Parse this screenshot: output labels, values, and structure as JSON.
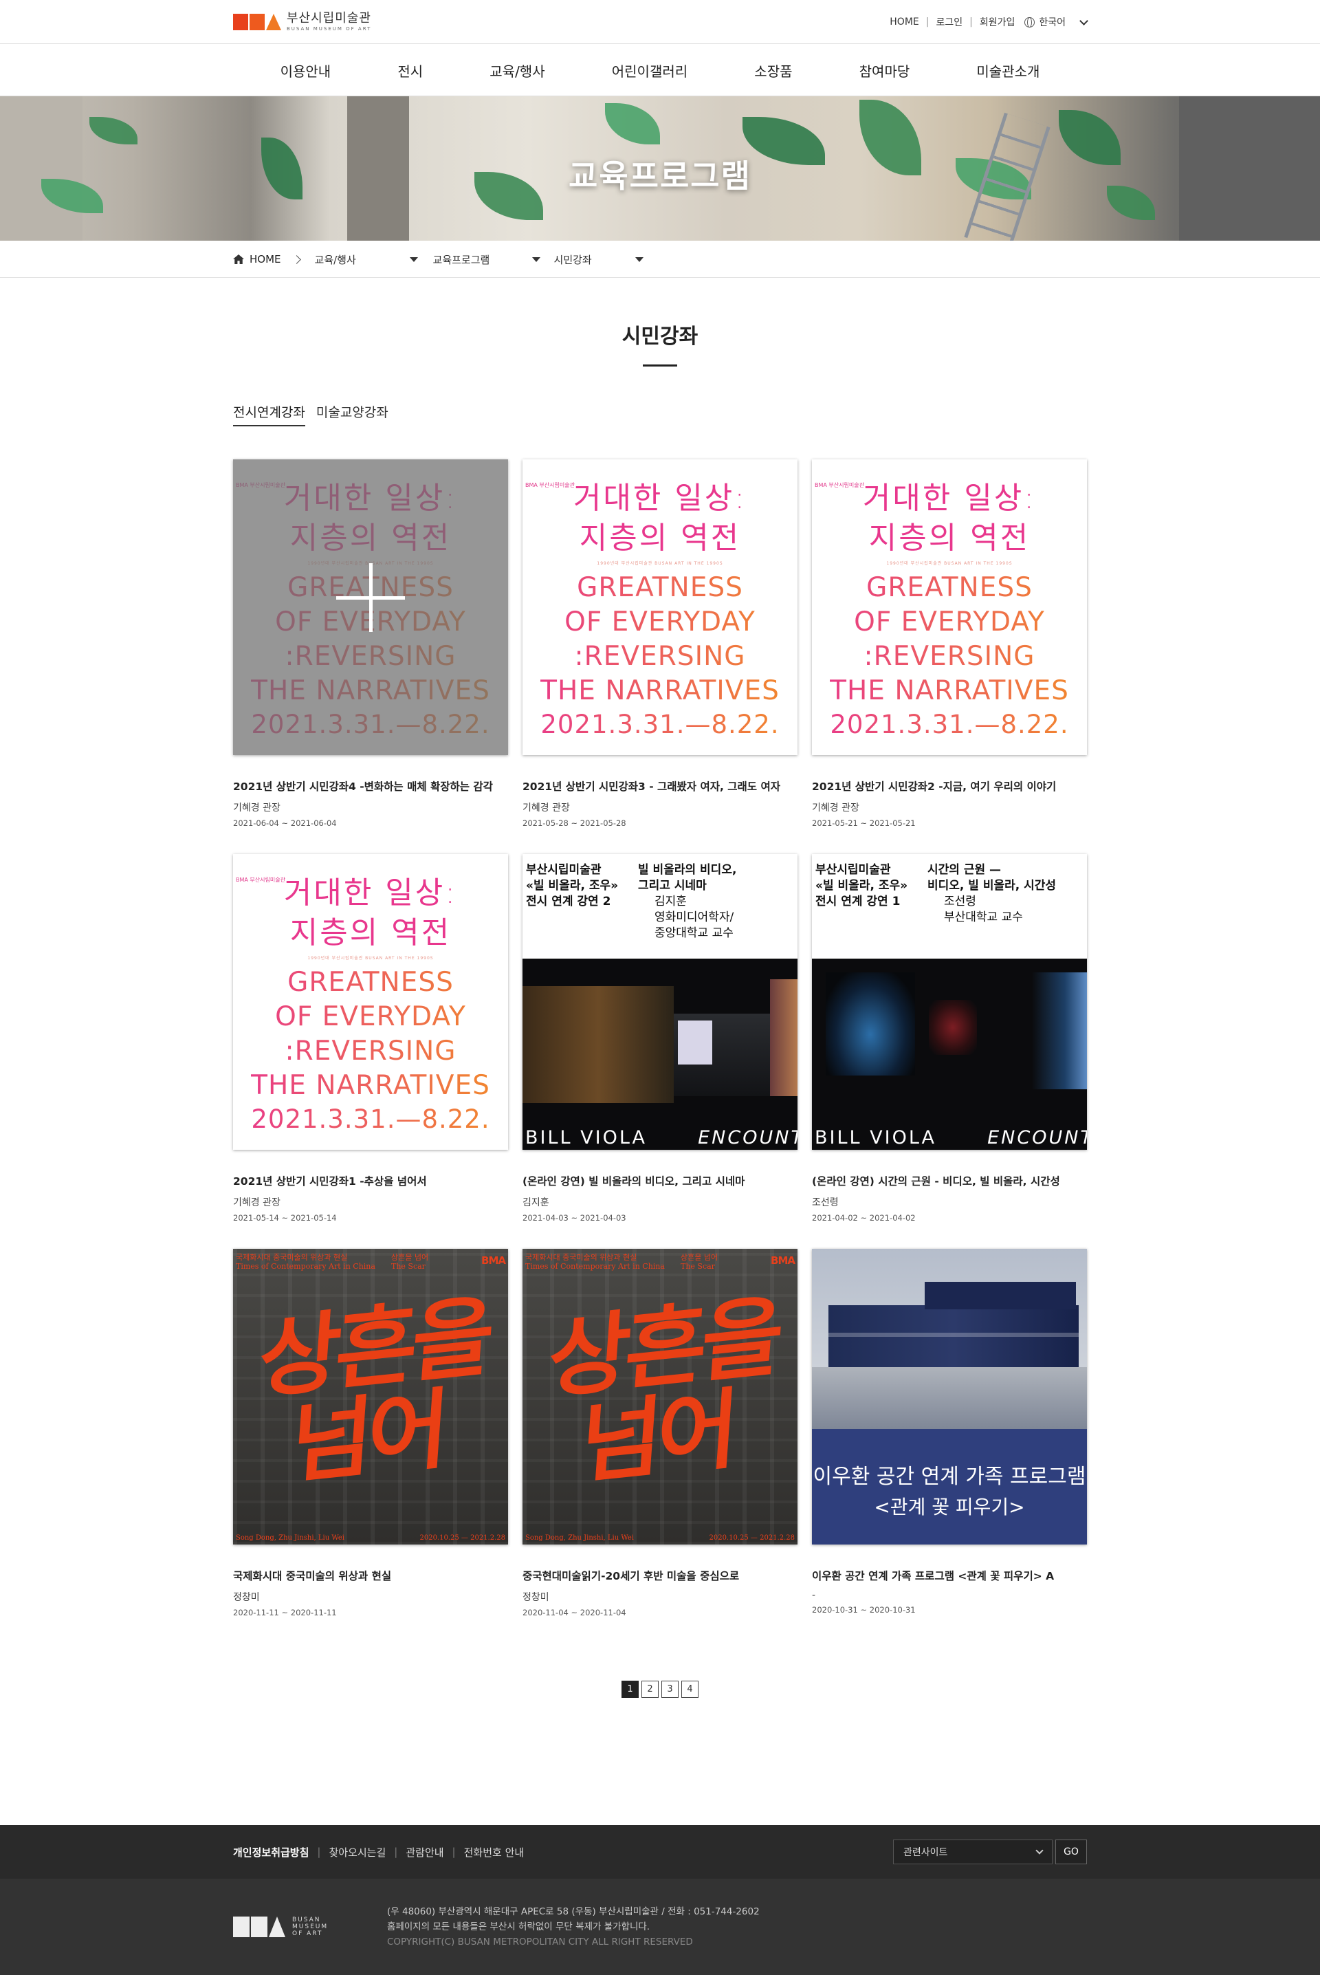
{
  "header": {
    "logo_ko": "부산시립미술관",
    "logo_en": "BUSAN MUSEUM OF ART",
    "util": [
      "HOME",
      "로그인",
      "회원가입"
    ],
    "lang": "한국어"
  },
  "gnb": [
    "이용안내",
    "전시",
    "교육/행사",
    "어린이갤러리",
    "소장품",
    "참여마당",
    "미술관소개"
  ],
  "banner": {
    "title": "교육프로그램"
  },
  "breadcrumb": {
    "home": "HOME",
    "level1": "교육/행사",
    "level2": "교육프로그램",
    "level3": "시민강좌"
  },
  "page": {
    "title": "시민강좌"
  },
  "tabs": [
    {
      "label": "전시연계강좌",
      "active": true
    },
    {
      "label": "미술교양강좌",
      "active": false
    }
  ],
  "poster_greatness": {
    "bma": "BMA 부산시립미술관",
    "ko1": "거대한 일상:",
    "ko2": "지층의 역전",
    "small": "1990년대 부산시립미술관   BUSAN ART IN THE 1990S",
    "en1": "GREATNESS",
    "en2": "OF EVERYDAY",
    "en3": ":REVERSING",
    "en4": "THE NARRATIVES",
    "date": "2021.3.31.—8.22."
  },
  "poster_viola": [
    {
      "c1": [
        "부산시립미술관",
        "«빌 비올라, 조우»",
        "전시 연계 강연 2"
      ],
      "c2": [
        "빌 비올라의 비디오,",
        "그리고 시네마"
      ],
      "c3": [
        "김지훈",
        "영화미디어학자/",
        "중앙대학교 교수"
      ],
      "brand_left": "BILL VIOLA",
      "brand_right": "ENCOUNTE"
    },
    {
      "c1": [
        "부산시립미술관",
        "«빌 비올라, 조우»",
        "전시 연계 강연 1"
      ],
      "c2": [
        "시간의 근원 —",
        "비디오, 빌 비올라, 시간성"
      ],
      "c3": [
        "조선령",
        "부산대학교 교수"
      ],
      "brand_left": "BILL VIOLA",
      "brand_right": "ENCOUNTE"
    }
  ],
  "poster_china": {
    "head": [
      "국제화시대 중국미술의 위상과 현실",
      "Times of Contemporary Art in China"
    ],
    "head2": [
      "상흔을 넘어",
      "The Scar"
    ],
    "logo": "BMA",
    "big": "상흔을 넘어",
    "foot_left": "Song Dong, Zhu Jinshi, Liu Wei",
    "foot_right": "2020.10.25 — 2021.2.28"
  },
  "poster_ufan": {
    "t1": "이우환 공간 연계 가족 프로그램",
    "t2": "<관계 꽃 피우기>"
  },
  "cards": [
    {
      "title": "2021년 상반기 시민강좌4 -변화하는 매체 확장하는 감각",
      "sub": "기혜경 관장",
      "date": "2021-06-04 ~ 2021-06-04"
    },
    {
      "title": "2021년 상반기 시민강좌3 - 그래봤자 여자, 그래도 여자",
      "sub": "기혜경 관장",
      "date": "2021-05-28 ~ 2021-05-28"
    },
    {
      "title": "2021년 상반기 시민강좌2 -지금, 여기 우리의 이야기",
      "sub": "기혜경 관장",
      "date": "2021-05-21 ~ 2021-05-21"
    },
    {
      "title": "2021년 상반기 시민강좌1 -추상을 넘어서",
      "sub": "기혜경 관장",
      "date": "2021-05-14 ~ 2021-05-14"
    },
    {
      "title": "(온라인 강연) 빌 비올라의 비디오, 그리고 시네마",
      "sub": "김지훈",
      "date": "2021-04-03 ~ 2021-04-03"
    },
    {
      "title": "(온라인 강연) 시간의 근원 - 비디오, 빌 비올라, 시간성",
      "sub": "조선령",
      "date": "2021-04-02 ~ 2021-04-02"
    },
    {
      "title": "국제화시대 중국미술의 위상과 현실",
      "sub": "정창미",
      "date": "2020-11-11 ~ 2020-11-11"
    },
    {
      "title": "중국현대미술읽기-20세기 후반 미술을 중심으로",
      "sub": "정창미",
      "date": "2020-11-04 ~ 2020-11-04"
    },
    {
      "title": "이우환 공간 연계 가족 프로그램 <관계 꽃 피우기> A",
      "sub": "-",
      "date": "2020-10-31 ~ 2020-10-31"
    }
  ],
  "pagination": {
    "pages": [
      "1",
      "2",
      "3",
      "4"
    ],
    "current": "1"
  },
  "footer": {
    "links": [
      "개인정보취급방침",
      "찾아오시는길",
      "관람안내",
      "전화번호 안내"
    ],
    "related": "관련사이트",
    "go": "GO",
    "logo_text": [
      "BUSAN",
      "MUSEUM",
      "OF ART"
    ],
    "address": "(우 48060) 부산광역시 해운대구 APEC로 58 (우동) 부산시립미술관 / 전화 : 051-744-2602",
    "notice": "홈페이지의 모든 내용들은 부산시 허락없이 무단 복제가 불가합니다.",
    "copyright": "COPYRIGHT(C) BUSAN METROPOLITAN CITY ALL RIGHT RESERVED"
  }
}
